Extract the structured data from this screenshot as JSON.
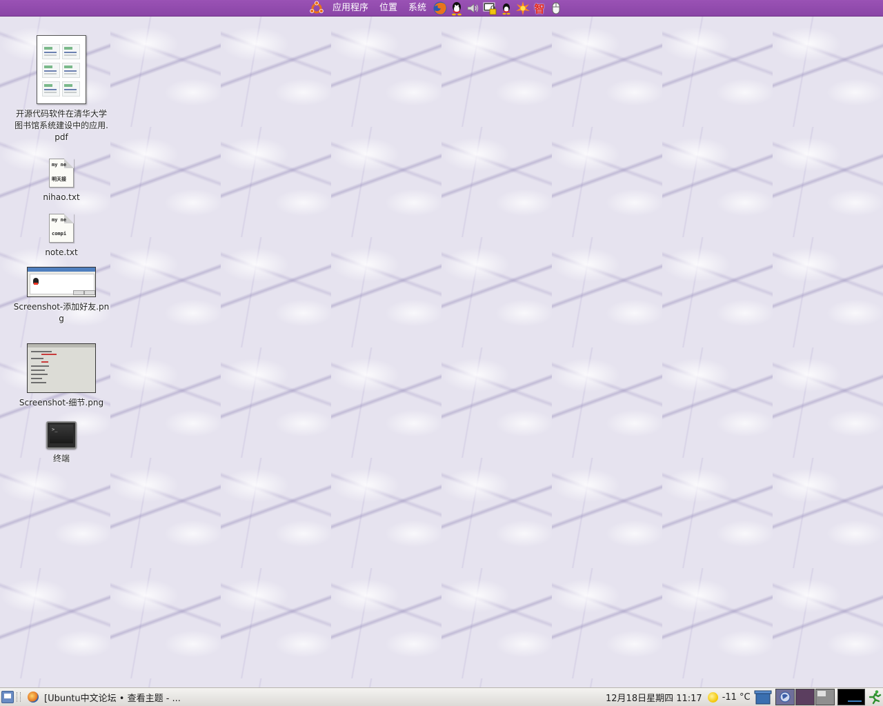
{
  "top_panel": {
    "menus": {
      "applications": "应用程序",
      "places": "位置",
      "system": "系统"
    },
    "launchers": [
      "firefox-icon",
      "qq-icon",
      "volume-icon",
      "lock-screen-icon",
      "qq-tray-icon",
      "burst-icon",
      "zhi-icon",
      "mouse-icon"
    ],
    "zhi_glyph": "智"
  },
  "desktop": {
    "icons": [
      {
        "label": "开源代码软件在清华大学图书馆系统建设中的应用.pdf",
        "kind": "pdf"
      },
      {
        "label": "nihao.txt",
        "kind": "text",
        "preview_line1": "my ne",
        "preview_line2": "明天接"
      },
      {
        "label": "note.txt",
        "kind": "text",
        "preview_line1": "my ne",
        "preview_line2": "compi"
      },
      {
        "label": "Screenshot-添加好友.png",
        "kind": "image"
      },
      {
        "label": "Screenshot-细节.png",
        "kind": "image"
      },
      {
        "label": "终端",
        "kind": "terminal",
        "prompt": ">_"
      }
    ]
  },
  "bottom_panel": {
    "task_label": "[Ubuntu中文论坛 • 查看主题 - ...",
    "clock": "12月18日星期四  11:17",
    "temperature": "-11 °C"
  },
  "colors": {
    "top_panel": "#9549b0",
    "desktop": "#e6e3ef",
    "bottom_panel": "#e8e6e2"
  }
}
